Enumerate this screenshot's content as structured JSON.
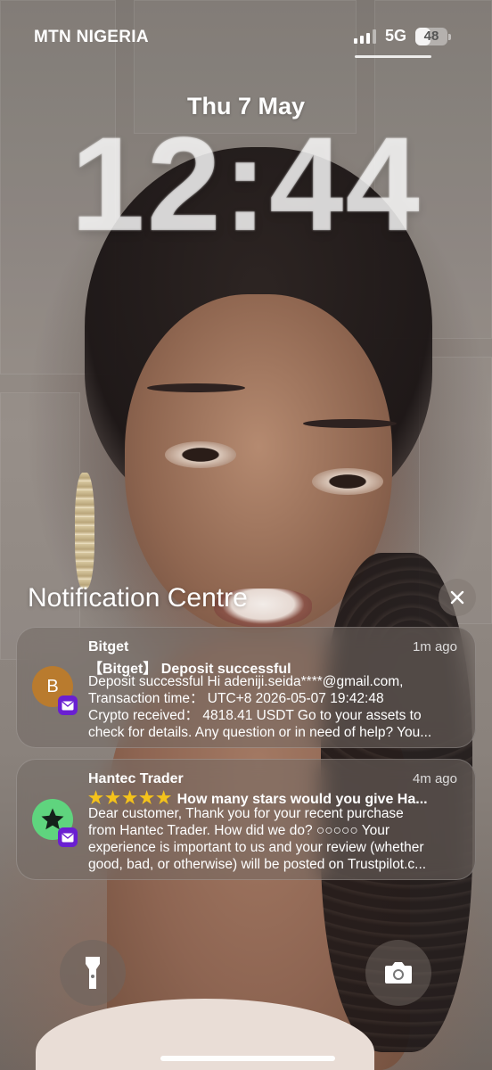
{
  "status_bar": {
    "carrier": "MTN NIGERIA",
    "network": "5G",
    "battery": "48",
    "battery_level": 0.48
  },
  "lock_screen": {
    "date": "Thu 7 May",
    "time": "12:44"
  },
  "notification_centre": {
    "title": "Notification Centre",
    "close_icon": "close-icon"
  },
  "notifications": [
    {
      "app": "Bitget",
      "time": "1m ago",
      "avatar_letter": "B",
      "avatar_color": "#b97b2e",
      "title": "【Bitget】 Deposit successful",
      "body_lines": [
        "Deposit successful Hi adeniji.seida****@gmail.com,",
        "Transaction time： UTC+8 2026-05-07 19:42:48",
        "Crypto received： 4818.41 USDT Go to your assets to",
        "check for details. Any question or in need of help? You..."
      ],
      "badge": "yahoo-mail-icon"
    },
    {
      "app": "Hantec Trader",
      "time": "4m ago",
      "avatar_color": "#5fd47e",
      "title_stars": "★★★★★",
      "title": "How many stars would you give Ha...",
      "body_lines": [
        "Dear customer, Thank you for your recent purchase",
        "from Hantec Trader. How did we do? ○○○○○ Your",
        "experience is important to us and your review (whether",
        "good, bad, or otherwise) will be posted on Trustpilot.c..."
      ],
      "badge": "yahoo-mail-icon"
    }
  ],
  "quick_actions": {
    "left": "flashlight-icon",
    "right": "camera-icon"
  }
}
